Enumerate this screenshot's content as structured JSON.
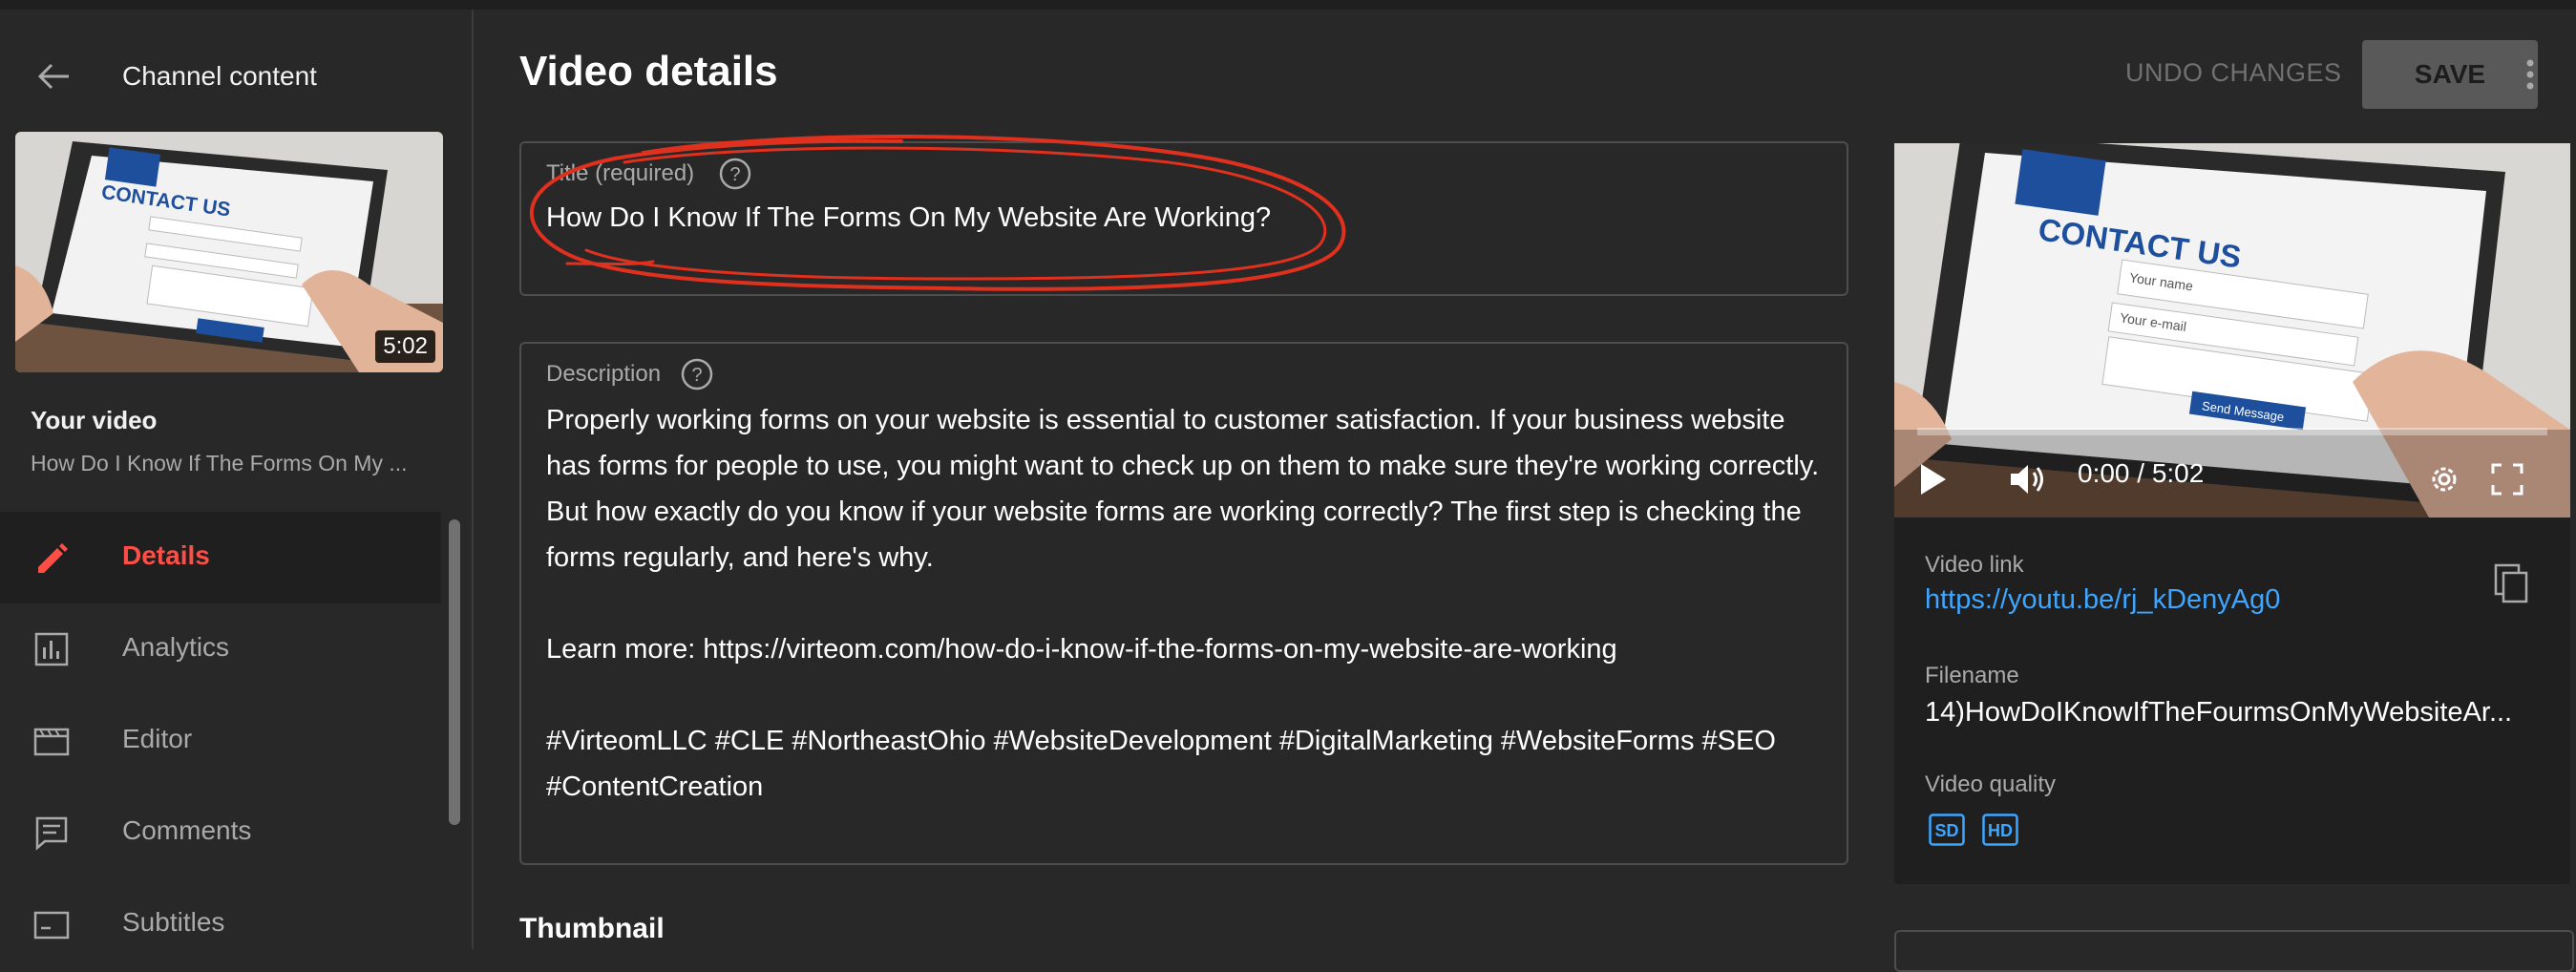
{
  "sidebar": {
    "header_label": "Channel content",
    "thumbnail_duration": "5:02",
    "your_video_label": "Your video",
    "video_title_truncated": "How Do I Know If The Forms On My ...",
    "nav": [
      {
        "label": "Details",
        "icon": "pencil-icon",
        "active": true
      },
      {
        "label": "Analytics",
        "icon": "analytics-icon",
        "active": false
      },
      {
        "label": "Editor",
        "icon": "editor-icon",
        "active": false
      },
      {
        "label": "Comments",
        "icon": "comments-icon",
        "active": false
      },
      {
        "label": "Subtitles",
        "icon": "subtitles-icon",
        "active": false
      }
    ]
  },
  "header": {
    "title": "Video details",
    "undo_label": "UNDO CHANGES",
    "save_label": "SAVE"
  },
  "title_field": {
    "label": "Title (required)",
    "value": "How Do I Know If The Forms On My Website Are Working?"
  },
  "description_field": {
    "label": "Description",
    "paragraphs": [
      "Properly working forms on your website is essential to customer satisfaction. If your business website has forms for people to use, you might want to check up on them to make sure they're working correctly. But how exactly do you know if your website forms are working correctly? The first step is checking the forms regularly, and here's why.",
      "Learn more: https://virteom.com/how-do-i-know-if-the-forms-on-my-website-are-working",
      "#VirteomLLC #CLE #NortheastOhio #WebsiteDevelopment #DigitalMarketing #WebsiteForms #SEO #ContentCreation"
    ]
  },
  "thumbnail_section": {
    "heading": "Thumbnail"
  },
  "thumbnail_image": {
    "text": "CONTACT US",
    "field1": "Your name",
    "field2": "Your e-mail",
    "button": "Send Message"
  },
  "player": {
    "time": "0:00 / 5:02",
    "progress": 0
  },
  "video_info": {
    "link_label": "Video link",
    "link": "https://youtu.be/rj_kDenyAg0",
    "filename_label": "Filename",
    "filename": "14)HowDoIKnowIfTheFourmsOnMyWebsiteAr...",
    "quality_label": "Video quality",
    "qualities": [
      "SD",
      "HD"
    ]
  },
  "colors": {
    "accent_red": "#ff4e45",
    "link_blue": "#3ea6ff",
    "annotation_red": "#e0301e",
    "background": "#282828"
  }
}
